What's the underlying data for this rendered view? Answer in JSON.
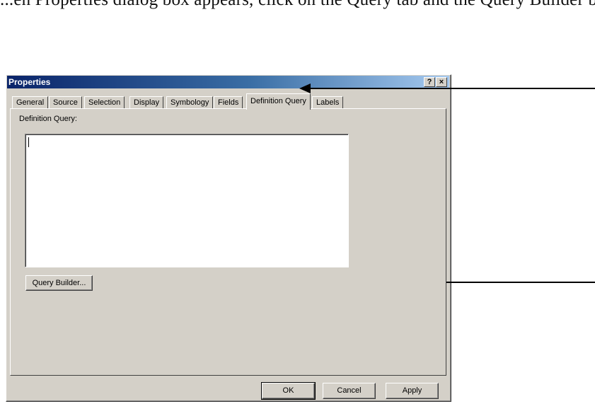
{
  "page_text": "...en Properties dialog box appears, click on the Query tab and the Query Builder button.",
  "window": {
    "title": "Properties",
    "help_glyph": "?",
    "close_glyph": "×"
  },
  "tabs": [
    {
      "label": "General",
      "active": false
    },
    {
      "label": "Source",
      "active": false
    },
    {
      "label": "Selection",
      "active": false
    },
    {
      "label": "Display",
      "active": false
    },
    {
      "label": "Symbology",
      "active": false
    },
    {
      "label": "Fields",
      "active": false
    },
    {
      "label": "Definition Query",
      "active": true
    },
    {
      "label": "Labels",
      "active": false
    }
  ],
  "panel": {
    "definition_query_label": "Definition Query:",
    "query_text": "",
    "query_builder_label": "Query Builder..."
  },
  "footer": {
    "ok_label": "OK",
    "cancel_label": "Cancel",
    "apply_label": "Apply"
  },
  "colors": {
    "dialog_face": "#d4d0c8",
    "titlebar_start": "#0a246a",
    "titlebar_end": "#a6caf0",
    "annotation_arrow": "#000000"
  }
}
